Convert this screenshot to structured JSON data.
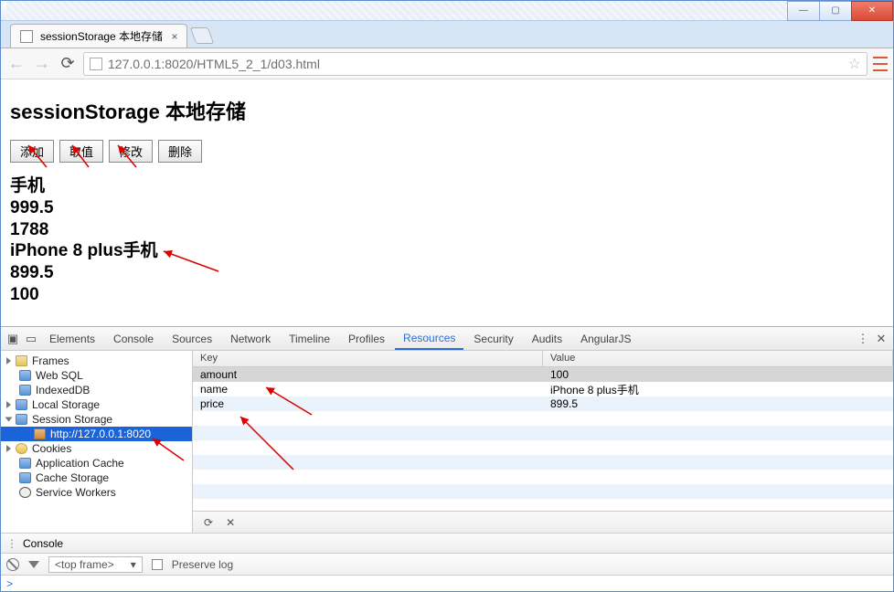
{
  "window": {
    "tab_title": "sessionStorage 本地存储",
    "url": "127.0.0.1:8020/HTML5_2_1/d03.html"
  },
  "page": {
    "heading": "sessionStorage 本地存储",
    "buttons": {
      "add": "添加",
      "get": "取值",
      "edit": "修改",
      "del": "删除"
    },
    "values": {
      "l1": "手机",
      "l2": "999.5",
      "l3": "1788",
      "l4": "iPhone 8 plus手机",
      "l5": "899.5",
      "l6": "100"
    }
  },
  "devtools": {
    "tabs": {
      "elements": "Elements",
      "console": "Console",
      "sources": "Sources",
      "network": "Network",
      "timeline": "Timeline",
      "profiles": "Profiles",
      "resources": "Resources",
      "security": "Security",
      "audits": "Audits",
      "angular": "AngularJS"
    },
    "tree": {
      "frames": "Frames",
      "websql": "Web SQL",
      "indexeddb": "IndexedDB",
      "localstorage": "Local Storage",
      "sessionstorage": "Session Storage",
      "origin": "http://127.0.0.1:8020",
      "cookies": "Cookies",
      "appcache": "Application Cache",
      "cachestorage": "Cache Storage",
      "sw": "Service Workers"
    },
    "table": {
      "headers": {
        "key": "Key",
        "value": "Value"
      },
      "rows": [
        {
          "key": "amount",
          "value": "100"
        },
        {
          "key": "name",
          "value": "iPhone 8 plus手机"
        },
        {
          "key": "price",
          "value": "899.5"
        }
      ]
    },
    "console": {
      "label": "Console",
      "topframe": "<top frame>",
      "preserve": "Preserve log",
      "prompt": ">"
    }
  }
}
